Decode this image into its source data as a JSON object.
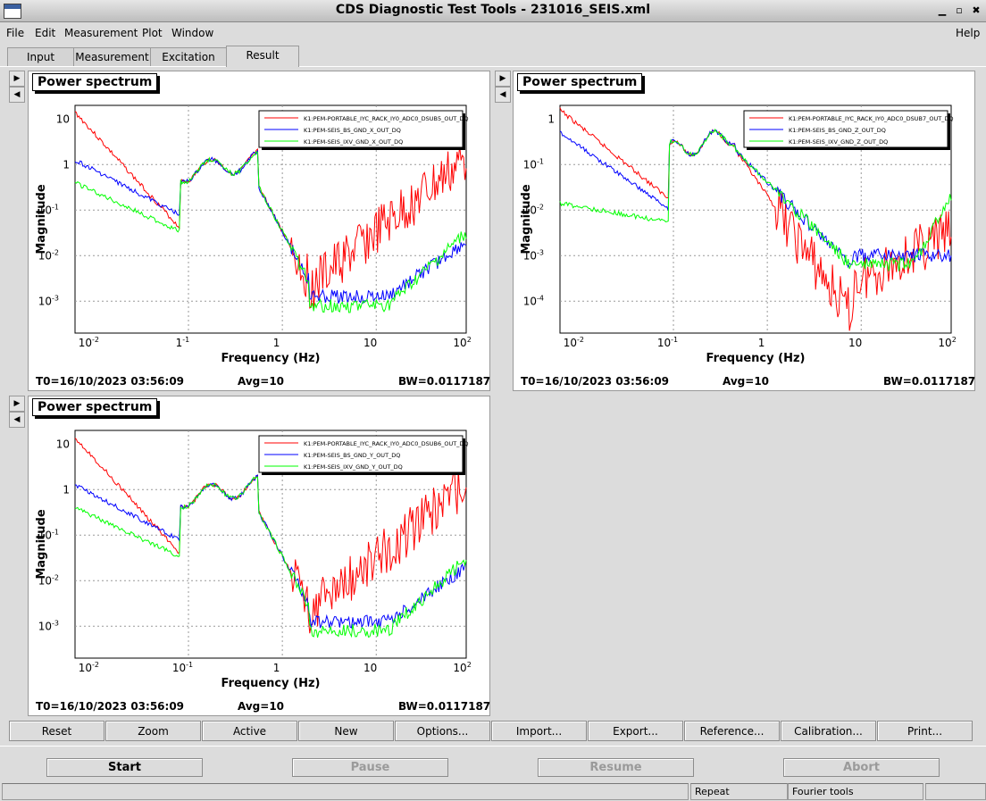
{
  "window": {
    "title": "CDS Diagnostic Test Tools - 231016_SEIS.xml"
  },
  "menu": {
    "file": "File",
    "edit": "Edit",
    "measurement": "Measurement",
    "plot": "Plot",
    "window": "Window",
    "help": "Help"
  },
  "tabs": {
    "input": "Input",
    "measurement": "Measurement",
    "excitation": "Excitation",
    "result": "Result",
    "active": "result"
  },
  "plots": [
    {
      "title": "Power spectrum",
      "legend": [
        "K1:PEM-PORTABLE_IYC_RACK_IY0_ADC0_DSUB5_OUT_DQ",
        "K1:PEM-SEIS_BS_GND_X_OUT_DQ",
        "K1:PEM-SEIS_IXV_GND_X_OUT_DQ"
      ],
      "xlabel": "Frequency (Hz)",
      "ylabel": "Magnitude",
      "xticks": [
        "10",
        "1",
        "1",
        "10",
        "10"
      ],
      "xtick_exp": [
        "-2",
        "-1",
        "",
        "",
        "2"
      ],
      "yticks": [
        "10",
        "1",
        "10",
        "10",
        "10"
      ],
      "ytick_exp": [
        "",
        "",
        "-1",
        "-2",
        "-3"
      ],
      "t0": "T0=16/10/2023 03:56:09",
      "avg": "Avg=10",
      "bw": "BW=0.0117187"
    },
    {
      "title": "Power spectrum",
      "legend": [
        "K1:PEM-PORTABLE_IYC_RACK_IY0_ADC0_DSUB7_OUT_DQ",
        "K1:PEM-SEIS_BS_GND_Z_OUT_DQ",
        "K1:PEM-SEIS_IXV_GND_Z_OUT_DQ"
      ],
      "xlabel": "Frequency (Hz)",
      "ylabel": "Magnitude",
      "xticks": [
        "10",
        "10",
        "1",
        "10",
        "10"
      ],
      "xtick_exp": [
        "-2",
        "-1",
        "",
        "",
        "2"
      ],
      "yticks": [
        "1",
        "10",
        "10",
        "10",
        "10"
      ],
      "ytick_exp": [
        "",
        "-1",
        "-2",
        "-3",
        "-4"
      ],
      "t0": "T0=16/10/2023 03:56:09",
      "avg": "Avg=10",
      "bw": "BW=0.0117187"
    },
    {
      "title": "Power spectrum",
      "legend": [
        "K1:PEM-PORTABLE_IYC_RACK_IY0_ADC0_DSUB6_OUT_DQ",
        "K1:PEM-SEIS_BS_GND_Y_OUT_DQ",
        "K1:PEM-SEIS_IXV_GND_Y_OUT_DQ"
      ],
      "xlabel": "Frequency (Hz)",
      "ylabel": "Magnitude",
      "xticks": [
        "10",
        "10",
        "1",
        "10",
        "10"
      ],
      "xtick_exp": [
        "-2",
        "-1",
        "",
        "",
        "2"
      ],
      "yticks": [
        "10",
        "1",
        "10",
        "10",
        "10"
      ],
      "ytick_exp": [
        "",
        "",
        "-1",
        "-2",
        "-3"
      ],
      "t0": "T0=16/10/2023 03:56:09",
      "avg": "Avg=10",
      "bw": "BW=0.0117187"
    }
  ],
  "toolbar": {
    "reset": "Reset",
    "zoom": "Zoom",
    "active": "Active",
    "new": "New",
    "options": "Options...",
    "import": "Import...",
    "export": "Export...",
    "reference": "Reference...",
    "calibration": "Calibration...",
    "print": "Print..."
  },
  "controls": {
    "start": "Start",
    "pause": "Pause",
    "resume": "Resume",
    "abort": "Abort"
  },
  "status": {
    "repeat": "Repeat",
    "fourier": "Fourier tools"
  },
  "colors": {
    "series_1": "#ff0000",
    "series_2": "#0000ff",
    "series_3": "#00ff00"
  }
}
